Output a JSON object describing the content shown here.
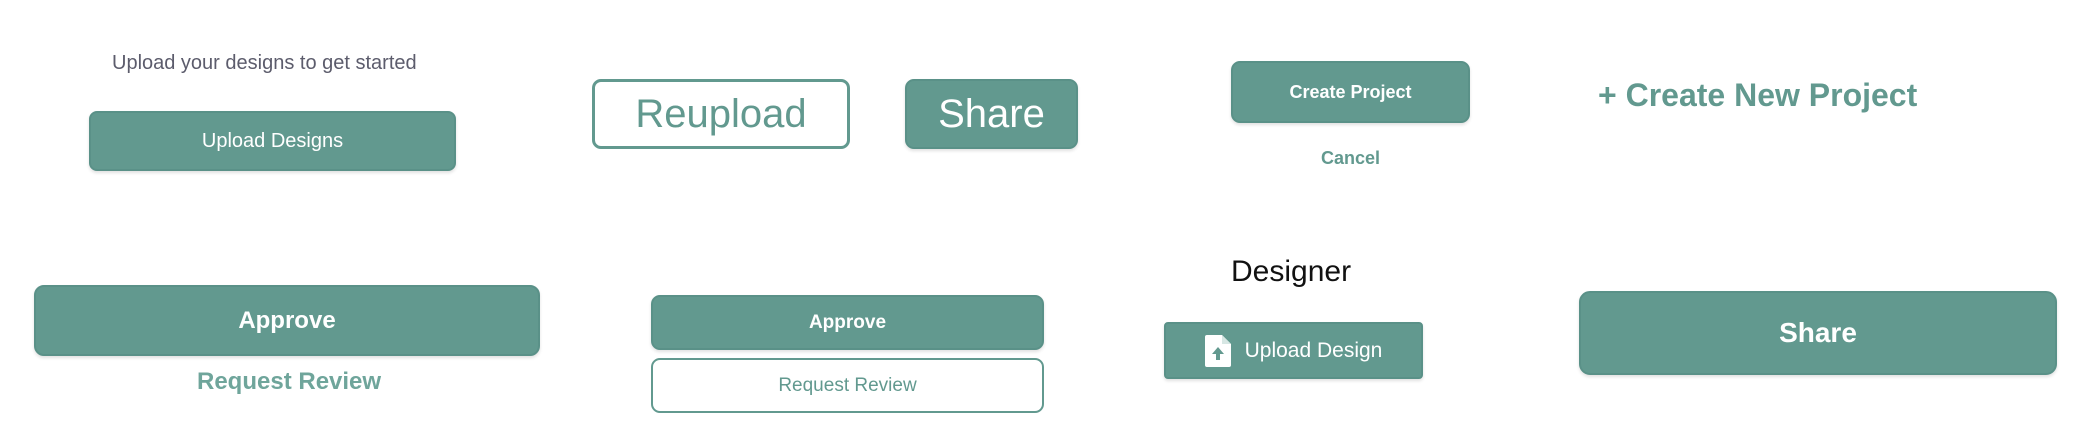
{
  "row1": {
    "upload_prompt": "Upload your designs to get started",
    "upload_designs_label": "Upload Designs",
    "reupload_label": "Reupload",
    "share_label": "Share",
    "create_project_label": "Create Project",
    "cancel_label": "Cancel",
    "create_new_project_label": "+ Create New Project"
  },
  "row2": {
    "approve_large_label": "Approve",
    "request_review_link_label": "Request Review",
    "approve_small_label": "Approve",
    "request_review_outline_label": "Request Review",
    "designer_heading": "Designer",
    "upload_design_label": "Upload Design",
    "share_wide_label": "Share"
  },
  "icons": {
    "upload_design_icon": "file-upload-icon"
  },
  "colors": {
    "accent": "#62998f",
    "text_muted": "#5c5c6c",
    "heading": "#111111"
  }
}
